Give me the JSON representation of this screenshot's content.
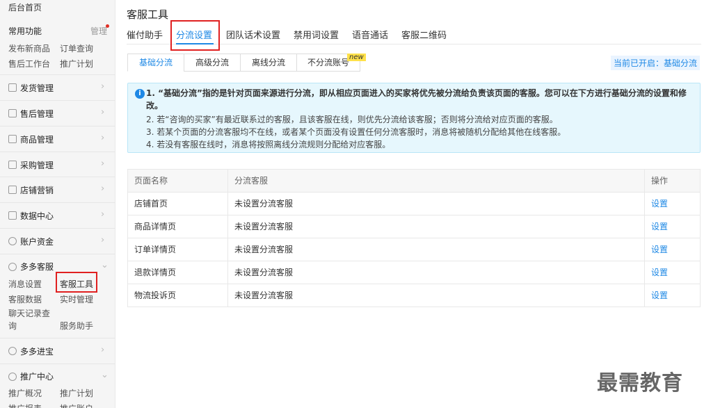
{
  "sidebar": {
    "home": "后台首页",
    "common_title": "常用功能",
    "manage": "管理",
    "common_links": [
      "发布新商品",
      "订单查询",
      "售后工作台",
      "推广计划"
    ],
    "items": [
      "发货管理",
      "售后管理",
      "商品管理",
      "采购管理",
      "店铺营销",
      "数据中心",
      "账户资金"
    ],
    "kefu_group": {
      "title": "多多客服",
      "links": [
        "消息设置",
        "客服工具",
        "客服数据",
        "实时管理",
        "聊天记录查",
        "询",
        "服务助手"
      ]
    },
    "jinbao": "多多进宝",
    "promo_group": {
      "title": "推广中心",
      "links": [
        "推广概况",
        "推广计划",
        "推广报表",
        "推广账户"
      ]
    }
  },
  "main": {
    "title": "客服工具",
    "tabs": [
      "催付助手",
      "分流设置",
      "团队话术设置",
      "禁用词设置",
      "语音通话",
      "客服二维码"
    ],
    "sub_tabs": [
      "基础分流",
      "高级分流",
      "离线分流",
      "不分流账号"
    ],
    "new_badge": "new",
    "current_status": "当前已开启：基础分流",
    "info": {
      "icon": "i",
      "lines": [
        "1. “基础分流”指的是针对页面来源进行分流，即从相应页面进入的买家将优先被分流给负责该页面的客服。您可以在下方进行基础分流的设置和修改。",
        "2. 若“咨询的买家”有最近联系过的客服，且该客服在线，则优先分流给该客服；否则将分流给对应页面的客服。",
        "3. 若某个页面的分流客服均不在线，或者某个页面没有设置任何分流客服时，消息将被随机分配给其他在线客服。",
        "4. 若没有客服在线时，消息将按照离线分流规则分配给对应客服。"
      ]
    },
    "table": {
      "headers": [
        "页面名称",
        "分流客服",
        "操作"
      ],
      "rows": [
        {
          "page": "店铺首页",
          "agent": "未设置分流客服",
          "action": "设置"
        },
        {
          "page": "商品详情页",
          "agent": "未设置分流客服",
          "action": "设置"
        },
        {
          "page": "订单详情页",
          "agent": "未设置分流客服",
          "action": "设置"
        },
        {
          "page": "退款详情页",
          "agent": "未设置分流客服",
          "action": "设置"
        },
        {
          "page": "物流投诉页",
          "agent": "未设置分流客服",
          "action": "设置"
        }
      ]
    }
  },
  "watermark": "最需教育",
  "colors": {
    "accent": "#1e88e5",
    "highlight": "#e02020",
    "info_bg": "#e6f7fd"
  }
}
